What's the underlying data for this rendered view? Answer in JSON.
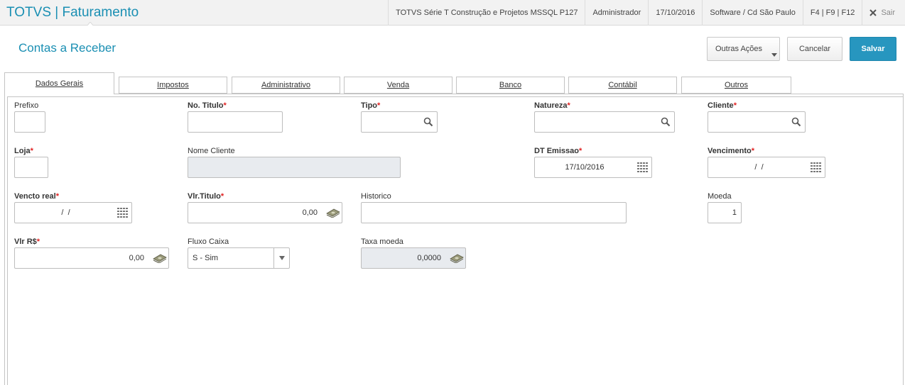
{
  "app": {
    "title": "TOTVS | Faturamento"
  },
  "topbar": {
    "environment": "TOTVS Série T Construção e Projetos MSSQL P127",
    "user": "Administrador",
    "date": "17/10/2016",
    "company": "Software / Cd São Paulo",
    "shortcuts": "F4 | F9 | F12",
    "exit_label": "Sair"
  },
  "header": {
    "title": "Contas a Receber",
    "more_actions_label": "Outras Ações",
    "cancel_label": "Cancelar",
    "save_label": "Salvar"
  },
  "tabs": [
    {
      "label": "Dados Gerais",
      "active": true
    },
    {
      "label": "Impostos"
    },
    {
      "label": "Administrativo"
    },
    {
      "label": "Venda"
    },
    {
      "label": "Banco"
    },
    {
      "label": "Contábil"
    },
    {
      "label": "Outros"
    }
  ],
  "form": {
    "required_mark": "*",
    "prefixo": {
      "label": "Prefixo",
      "value": ""
    },
    "no_titulo": {
      "label": "No. Titulo",
      "value": ""
    },
    "tipo": {
      "label": "Tipo",
      "value": ""
    },
    "natureza": {
      "label": "Natureza",
      "value": ""
    },
    "cliente": {
      "label": "Cliente",
      "value": ""
    },
    "loja": {
      "label": "Loja",
      "value": ""
    },
    "nome_cliente": {
      "label": "Nome Cliente",
      "value": ""
    },
    "dt_emissao": {
      "label": "DT Emissao",
      "value": "17/10/2016"
    },
    "vencimento": {
      "label": "Vencimento",
      "value": " /  /"
    },
    "vencto_real": {
      "label": "Vencto real",
      "value": " /  /"
    },
    "vlr_titulo": {
      "label": "Vlr.Titulo",
      "value": "0,00"
    },
    "historico": {
      "label": "Historico",
      "value": ""
    },
    "moeda": {
      "label": "Moeda",
      "value": "1"
    },
    "vlr_rs": {
      "label": "Vlr R$",
      "value": "0,00"
    },
    "fluxo_caixa": {
      "label": "Fluxo Caixa",
      "value": "S - Sim"
    },
    "taxa_moeda": {
      "label": "Taxa moeda",
      "value": "0,0000"
    }
  },
  "colors": {
    "accent": "#1a8fb3",
    "save_button": "#2796bf",
    "required": "#e02020",
    "readonly_bg": "#e8ebef"
  }
}
